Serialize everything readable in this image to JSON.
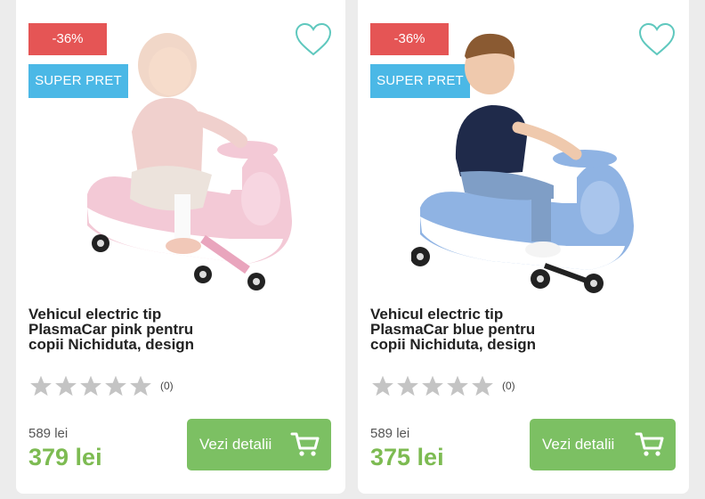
{
  "products": [
    {
      "discount": "-36%",
      "super_label": "SUPER PRET",
      "title": "Vehicul electric tip PlasmaCar pink pentru copii Nichiduta, design",
      "reviews": "(0)",
      "old_price": "589 lei",
      "new_price": "379 lei",
      "button_label": "Vezi detalii",
      "color_name": "pink",
      "rating": 0
    },
    {
      "discount": "-36%",
      "super_label": "SUPER PRET",
      "title": "Vehicul electric tip PlasmaCar blue pentru copii Nichiduta, design",
      "reviews": "(0)",
      "old_price": "589 lei",
      "new_price": "375 lei",
      "button_label": "Vezi detalii",
      "color_name": "blue",
      "rating": 0
    }
  ],
  "colors": {
    "discount_bg": "#e55555",
    "super_bg": "#4bb8e6",
    "price_green": "#7dbb52",
    "button_green": "#7cc063",
    "heart_teal": "#5fc8be",
    "star_gray": "#c4c4c4"
  },
  "icons": {
    "favorite": "heart-outline-icon",
    "cart": "shopping-cart-icon",
    "star": "star-icon"
  }
}
